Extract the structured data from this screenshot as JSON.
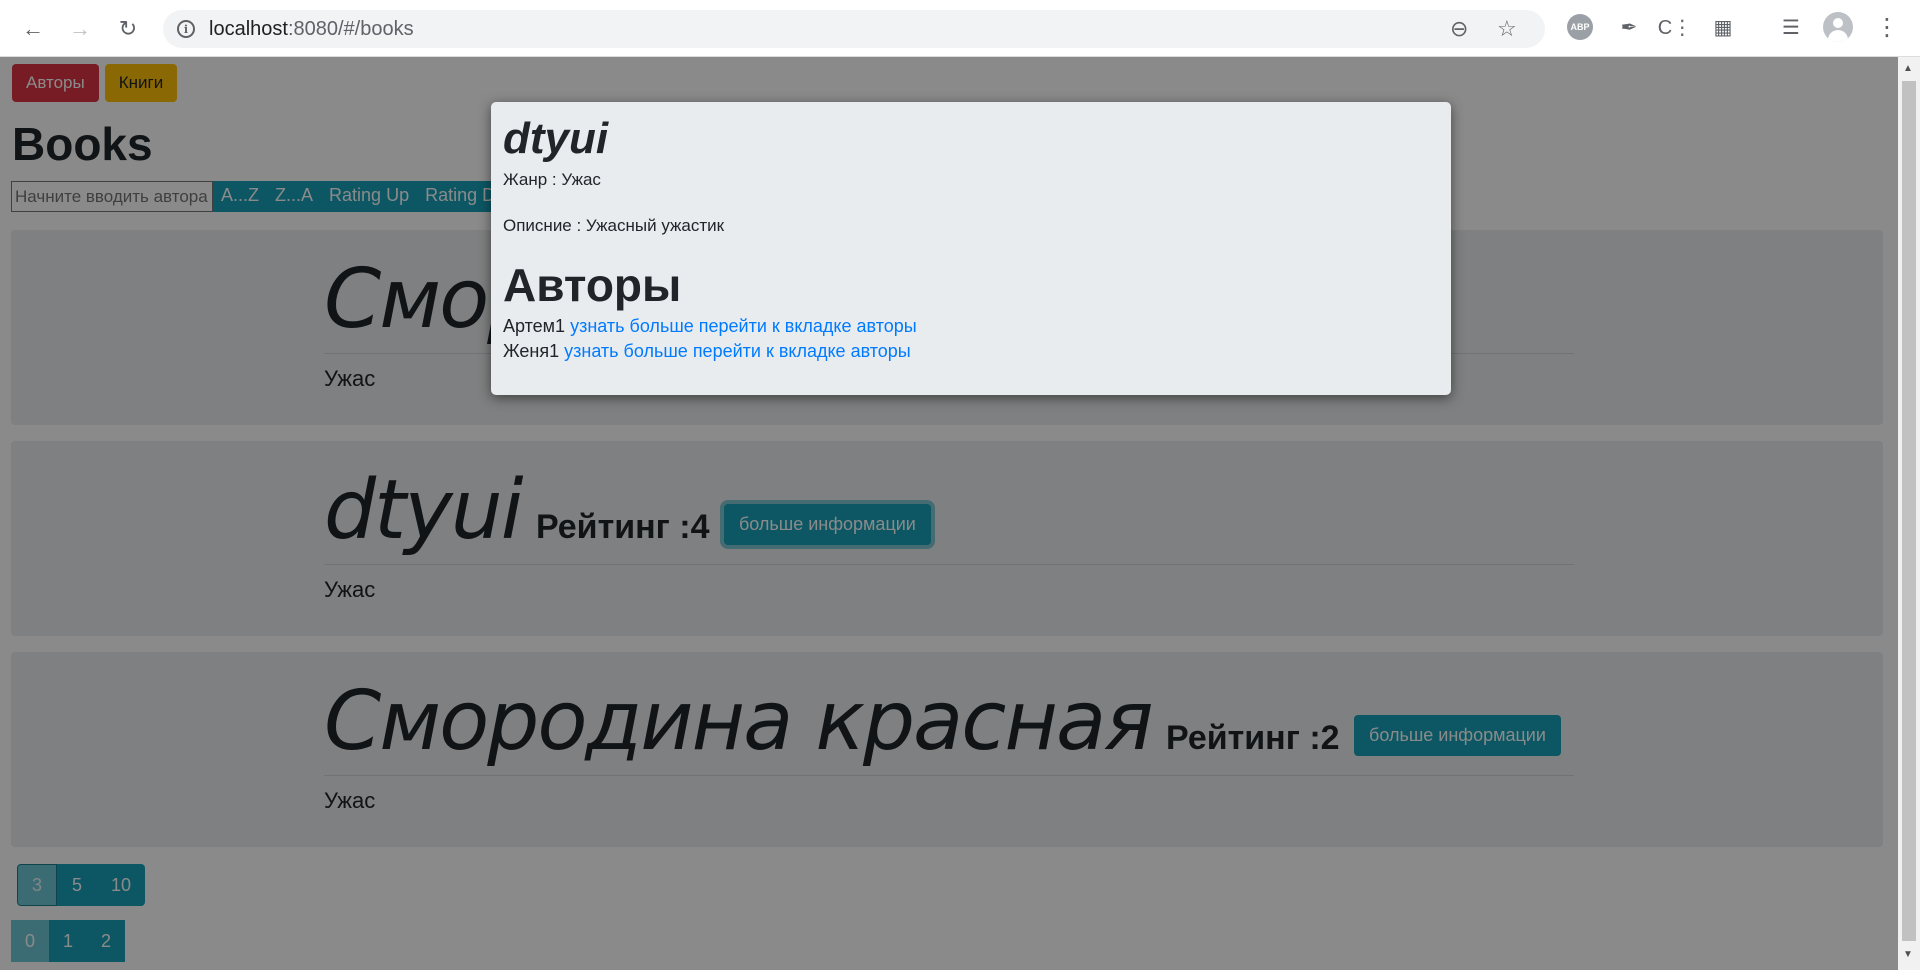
{
  "browser": {
    "url_host": "localhost",
    "url_rest": ":8080/#/books"
  },
  "nav": {
    "authors_label": "Авторы",
    "books_label": "Книги"
  },
  "page": {
    "title": "Books",
    "search_placeholder": "Начните вводить автора",
    "sort_buttons": [
      "A...Z",
      "Z...A",
      "Rating Up",
      "Rating Do"
    ]
  },
  "books": [
    {
      "title": "Смородина красная",
      "visible_title": "Смор",
      "genre": "Ужас"
    },
    {
      "title": "dtyui",
      "rating_label": "Рейтинг :4",
      "button_label": "больше информации",
      "genre": "Ужас"
    },
    {
      "title": "Смородина красная",
      "rating_label": "Рейтинг :2",
      "button_label": "больше информации",
      "genre": "Ужас"
    }
  ],
  "page_size_buttons": [
    "3",
    "5",
    "10"
  ],
  "page_buttons": [
    "0",
    "1",
    "2"
  ],
  "modal": {
    "title": "dtyui",
    "genre_line": "Жанр : Ужас",
    "description_line": "Описние : Ужасный ужастик",
    "authors_heading": "Авторы",
    "authors": [
      {
        "name": "Артем1",
        "link": "узнать больше перейти к вкладке авторы"
      },
      {
        "name": "Женя1",
        "link": "узнать больше перейти к вкладке авторы"
      }
    ]
  },
  "colors": {
    "info": "#17a2b8",
    "danger": "#dc3545",
    "warning": "#ffc107",
    "jumbotron": "#e9ecef",
    "link": "#007bff"
  }
}
